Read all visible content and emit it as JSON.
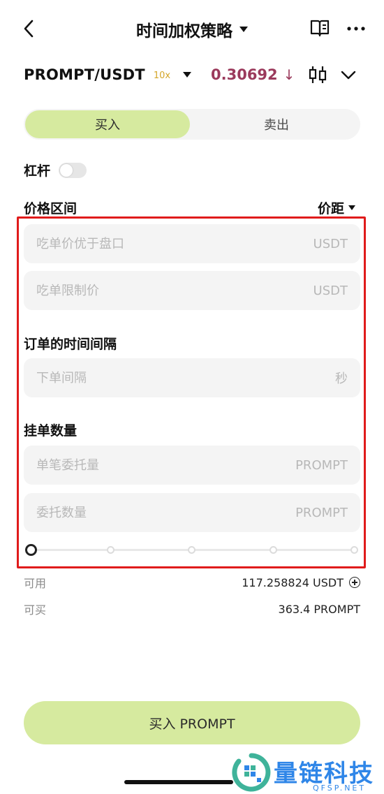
{
  "header": {
    "title": "时间加权策略"
  },
  "pair": {
    "symbol": "PROMPT/USDT",
    "leverage": "10x",
    "price": "0.30692",
    "price_direction": "down",
    "price_arrow": "↓",
    "price_color": "#9b3a5c"
  },
  "tabs": {
    "buy": "买入",
    "sell": "卖出",
    "active": "buy",
    "active_color": "#d6ea9f"
  },
  "leverage": {
    "label": "杠杆",
    "enabled": false
  },
  "price_range": {
    "label": "价格区间",
    "mode_label": "价距",
    "fields": [
      {
        "placeholder": "吃单价优于盘口",
        "unit": "USDT",
        "value": ""
      },
      {
        "placeholder": "吃单限制价",
        "unit": "USDT",
        "value": ""
      }
    ]
  },
  "interval": {
    "label": "订单的时间间隔",
    "field": {
      "placeholder": "下单间隔",
      "unit": "秒",
      "value": ""
    }
  },
  "quantity": {
    "label": "挂单数量",
    "fields": [
      {
        "placeholder": "单笔委托量",
        "unit": "PROMPT",
        "value": ""
      },
      {
        "placeholder": "委托数量",
        "unit": "PROMPT",
        "value": ""
      }
    ],
    "slider_percent": 0,
    "slider_stops": [
      0,
      25,
      50,
      75,
      100
    ]
  },
  "balance": {
    "available_label": "可用",
    "available_value": "117.258824 USDT",
    "buyable_label": "可买",
    "buyable_value": "363.4 PROMPT"
  },
  "submit": {
    "label": "买入 PROMPT"
  },
  "watermark": {
    "text": "量链科技",
    "sub": "QFSP.NET"
  },
  "highlight_color": "#e01b1b"
}
